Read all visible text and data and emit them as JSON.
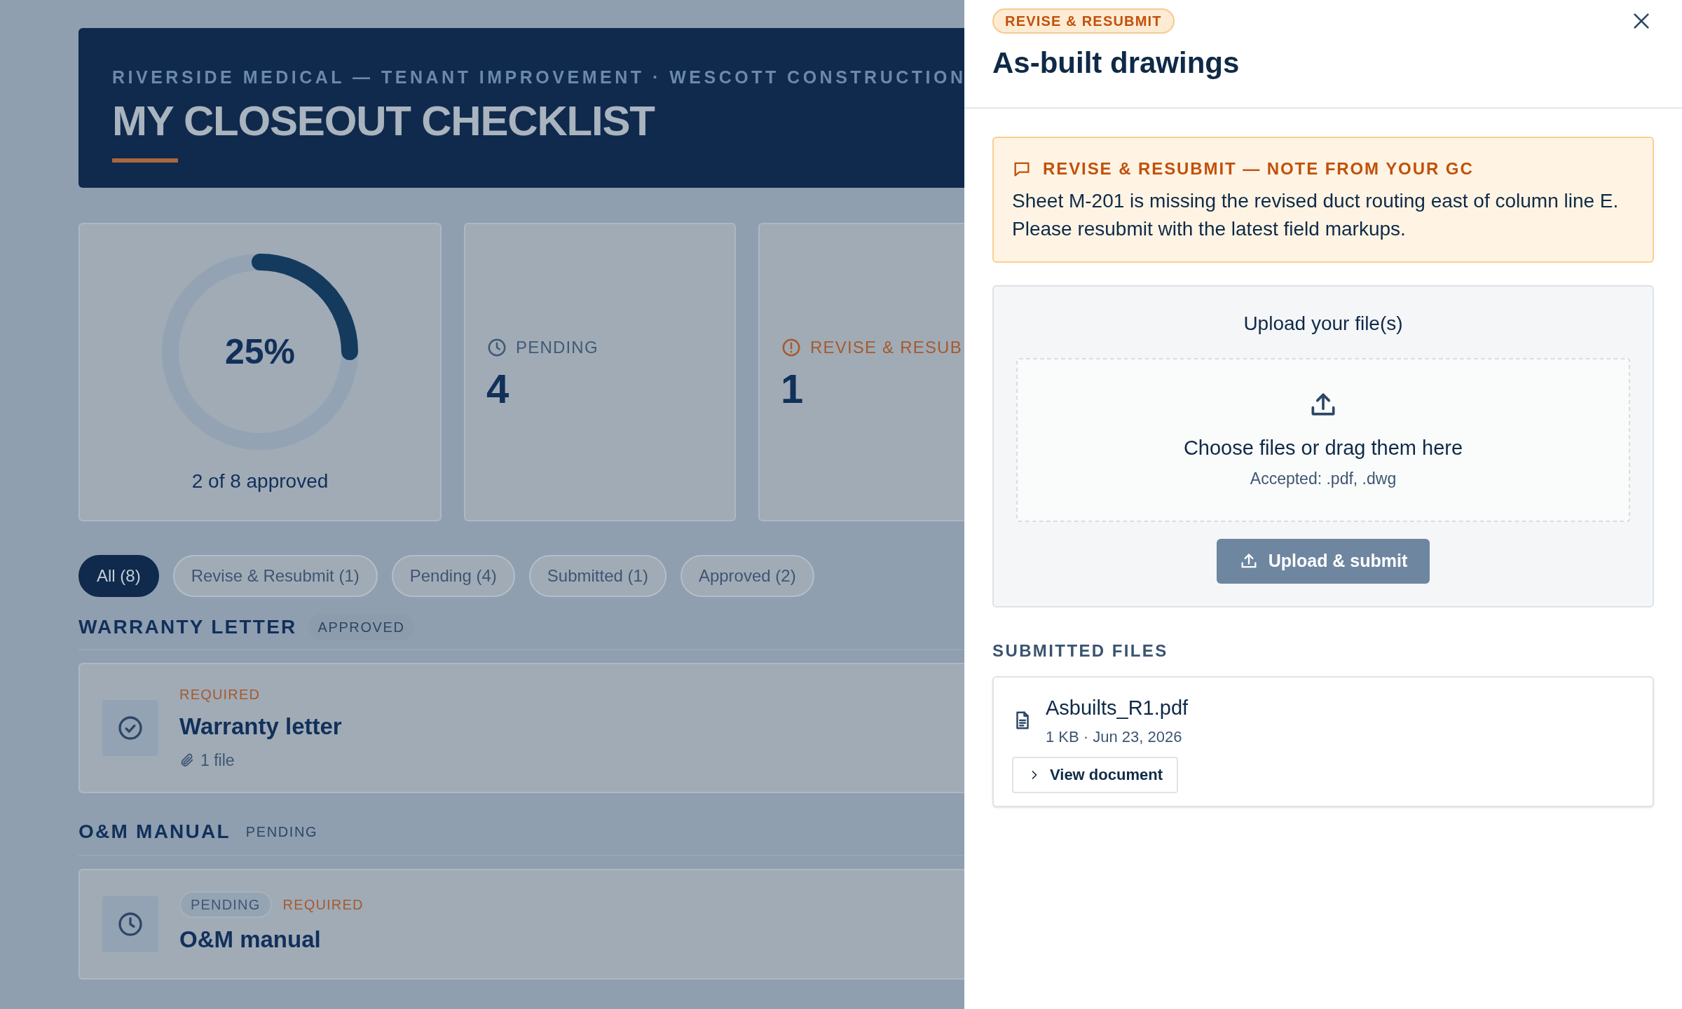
{
  "header": {
    "subtitle": "RIVERSIDE MEDICAL — TENANT IMPROVEMENT · WESCOTT CONSTRUCTION",
    "title": "MY CLOSEOUT CHECKLIST"
  },
  "progress": {
    "percent": "25%",
    "level": 0.25,
    "caption": "2 of 8 approved"
  },
  "stats": [
    {
      "kind": "pending",
      "label": "PENDING",
      "value": "4"
    },
    {
      "kind": "revise",
      "label": "REVISE & RESUB",
      "value": "1"
    }
  ],
  "filters": [
    {
      "label": "All (8)",
      "selected": true
    },
    {
      "label": "Revise & Resubmit (1)",
      "selected": false
    },
    {
      "label": "Pending (4)",
      "selected": false
    },
    {
      "label": "Submitted (1)",
      "selected": false
    },
    {
      "label": "Approved (2)",
      "selected": false
    }
  ],
  "sections": [
    {
      "title": "WARRANTY LETTER",
      "status": {
        "kind": "approved",
        "label": "APPROVED"
      },
      "items": [
        {
          "kind": "approved",
          "badges": [
            {
              "kind": "required",
              "label": "REQUIRED"
            }
          ],
          "title": "Warranty letter",
          "files": "1 file"
        }
      ]
    },
    {
      "title": "O&M MANUAL",
      "status": {
        "kind": "pending",
        "label": "PENDING"
      },
      "items": [
        {
          "kind": "pending",
          "badges": [
            {
              "kind": "pending",
              "label": "PENDING"
            },
            {
              "kind": "required",
              "label": "REQUIRED"
            }
          ],
          "title": "O&M manual"
        }
      ]
    }
  ],
  "panel": {
    "badge": "REVISE & RESUBMIT",
    "title": "As-built drawings",
    "note": {
      "heading": "REVISE & RESUBMIT — NOTE FROM YOUR GC",
      "text": "Sheet M-201 is missing the revised duct routing east of column line E. Please resubmit with the latest field markups."
    },
    "upload": {
      "heading": "Upload your file(s)",
      "prompt": "Choose files or drag them here",
      "accepted": "Accepted: .pdf, .dwg",
      "button": "Upload & submit",
      "disabled": true
    },
    "submitted_heading": "SUBMITTED FILES",
    "files": [
      {
        "name": "Asbuilts_R1.pdf",
        "meta": "1 KB · Jun 23, 2026",
        "action": "View document"
      }
    ]
  }
}
